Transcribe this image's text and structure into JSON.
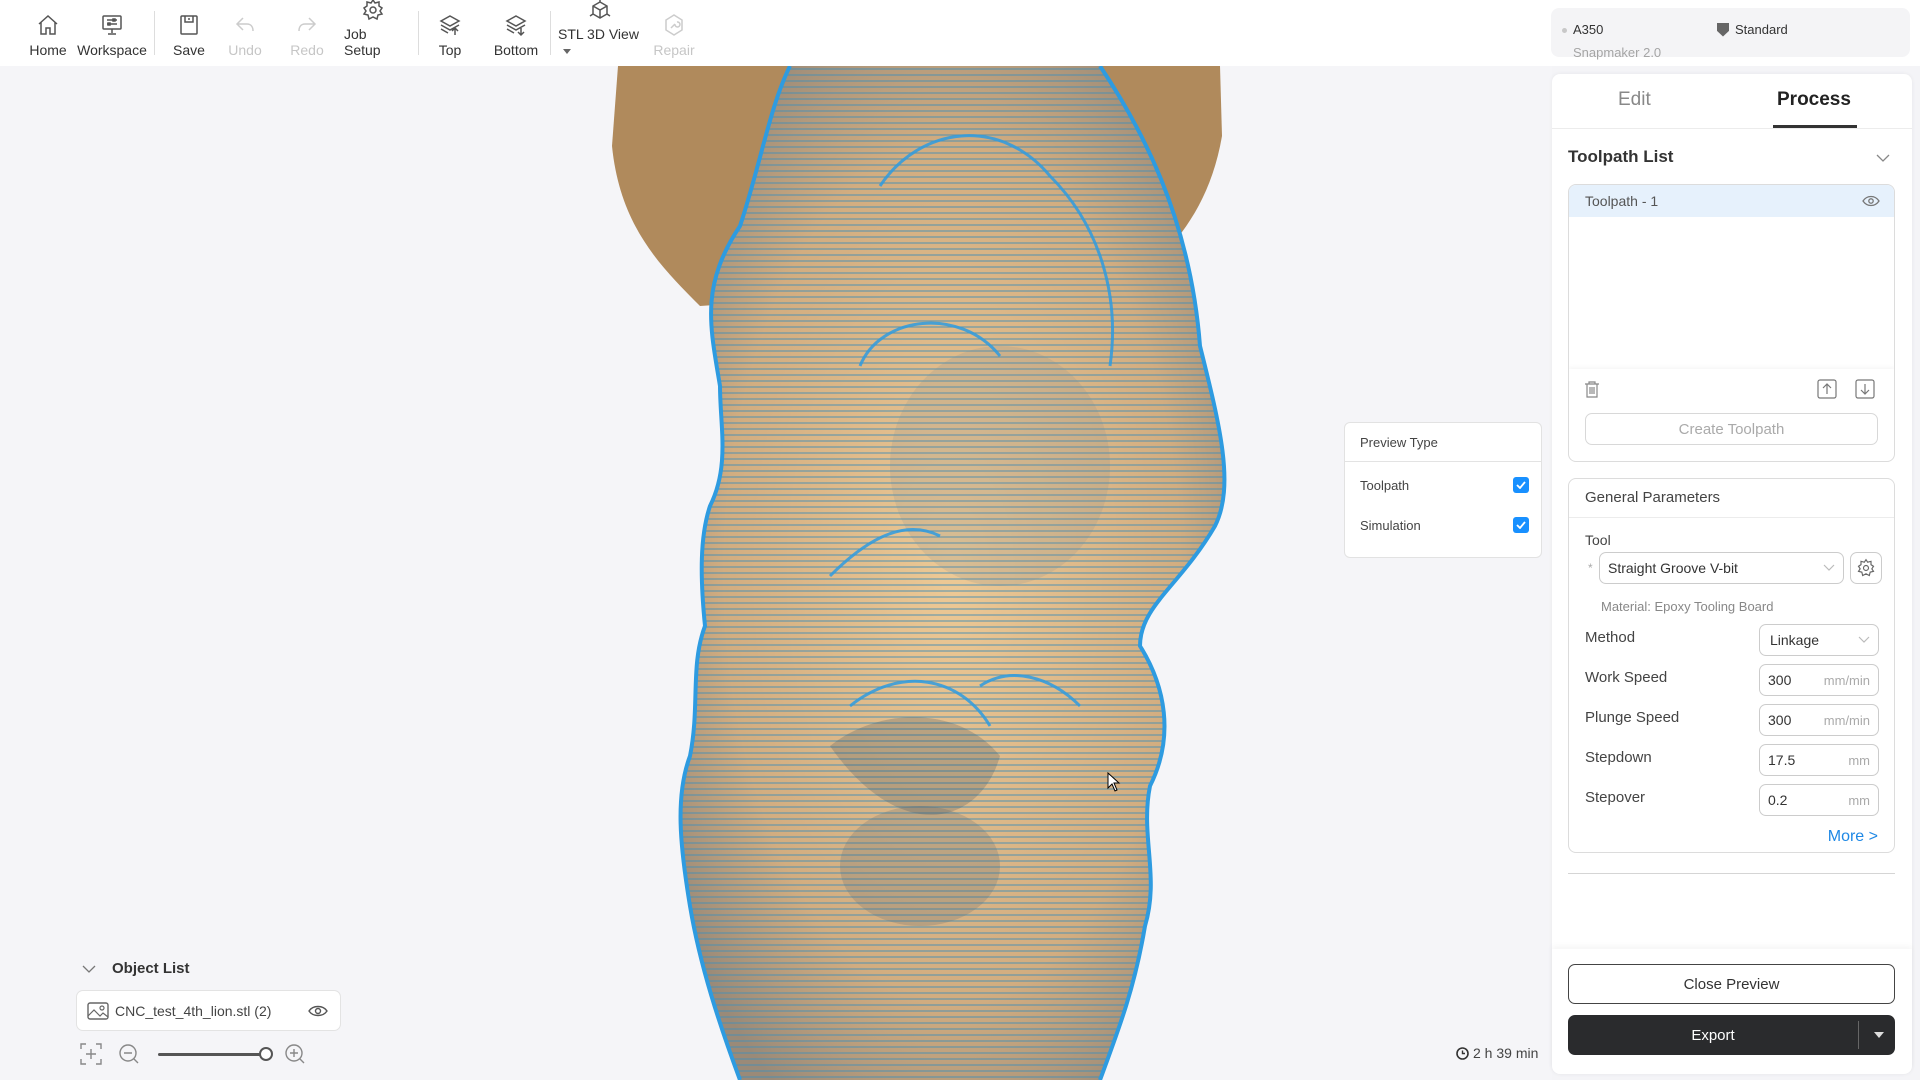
{
  "toolbar": {
    "items": [
      {
        "label": "Home",
        "icon": "home-icon",
        "enabled": true
      },
      {
        "label": "Workspace",
        "icon": "workspace-icon",
        "enabled": true
      },
      {
        "label": "Save",
        "icon": "save-icon",
        "enabled": true
      },
      {
        "label": "Undo",
        "icon": "undo-icon",
        "enabled": false
      },
      {
        "label": "Redo",
        "icon": "redo-icon",
        "enabled": false
      },
      {
        "label": "Job Setup",
        "icon": "gear-icon",
        "enabled": true
      },
      {
        "label": "Top",
        "icon": "layers-up-icon",
        "enabled": true
      },
      {
        "label": "Bottom",
        "icon": "layers-down-icon",
        "enabled": true
      },
      {
        "label": "STL 3D View",
        "icon": "cube-icon",
        "enabled": true,
        "has_dropdown": true
      },
      {
        "label": "Repair",
        "icon": "wrench-icon",
        "enabled": false
      }
    ]
  },
  "machine": {
    "name": "A350",
    "model": "Snapmaker 2.0",
    "mode": "Standard"
  },
  "preview_type": {
    "title": "Preview Type",
    "options": [
      {
        "label": "Toolpath",
        "checked": true
      },
      {
        "label": "Simulation",
        "checked": true
      }
    ]
  },
  "object_list": {
    "title": "Object List",
    "items": [
      {
        "name": "CNC_test_4th_lion.stl (2)",
        "visible": true
      }
    ],
    "zoom_level_fraction": 1.0
  },
  "estimate": {
    "time": "2 h 39 min"
  },
  "right_panel": {
    "tabs": [
      {
        "label": "Edit",
        "active": false
      },
      {
        "label": "Process",
        "active": true
      }
    ],
    "toolpath_list": {
      "title": "Toolpath List",
      "items": [
        {
          "name": "Toolpath - 1",
          "selected": true,
          "visible": true
        }
      ],
      "create_label": "Create Toolpath"
    },
    "general_parameters": {
      "title": "General Parameters",
      "tool_label": "Tool",
      "tool_required_mark": "*",
      "tool_value": "Straight Groove V-bit",
      "material": "Material: Epoxy Tooling Board",
      "method_label": "Method",
      "method_value": "Linkage",
      "fields": [
        {
          "label": "Work Speed",
          "value": "300",
          "unit": "mm/min"
        },
        {
          "label": "Plunge Speed",
          "value": "300",
          "unit": "mm/min"
        },
        {
          "label": "Stepdown",
          "value": "17.5",
          "unit": "mm"
        },
        {
          "label": "Stepover",
          "value": "0.2",
          "unit": "mm"
        }
      ],
      "more_label": "More >"
    },
    "close_preview_label": "Close Preview",
    "export_label": "Export"
  },
  "colors": {
    "toolpath": "#2e9be0",
    "model": "#e9c08c",
    "stock": "#b08a5c",
    "accent": "#1890ff",
    "link": "#1e88e5",
    "export_bg": "#2a2b2d"
  }
}
